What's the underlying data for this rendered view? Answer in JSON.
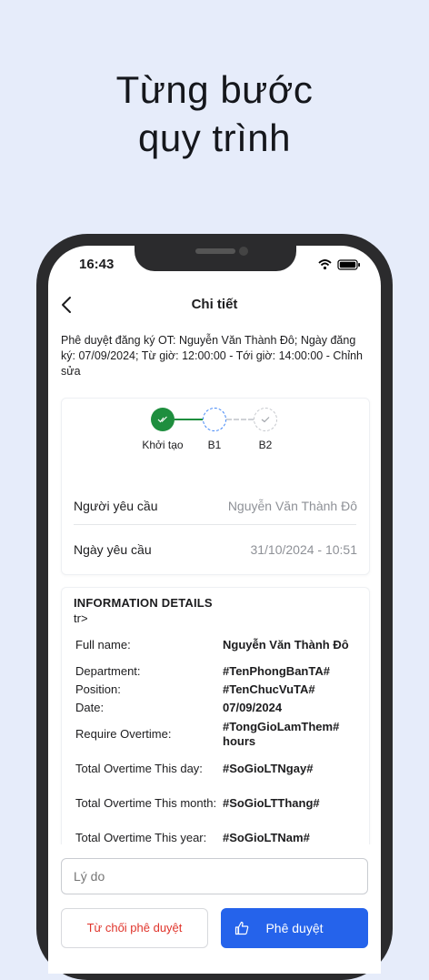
{
  "headline": {
    "line1": "Từng bước",
    "line2": "quy trình"
  },
  "status_bar": {
    "time": "16:43"
  },
  "nav": {
    "title": "Chi tiết",
    "back_icon": "chevron-left-icon"
  },
  "description": "Phê duyệt đăng ký OT: Nguyễn Văn Thành Đô; Ngày đăng ký: 07/09/2024; Từ giờ: 12:00:00 - Tới giờ: 14:00:00 - Chỉnh sửa",
  "workflow": {
    "steps": [
      {
        "label": "Khởi tạo",
        "state": "done"
      },
      {
        "label": "B1",
        "state": "current"
      },
      {
        "label": "B2",
        "state": "pending"
      }
    ]
  },
  "request": {
    "requester_label": "Người yêu cầu",
    "requester_value": "Nguyễn Văn Thành Đô",
    "date_label": "Ngày yêu cầu",
    "date_value": "31/10/2024 - 10:51"
  },
  "info": {
    "title": "INFORMATION DETAILS",
    "stray_text": "tr>",
    "rows": [
      {
        "key": "Full name:",
        "value": "Nguyễn Văn Thành Đô"
      },
      {
        "key": "Department:",
        "value": "#TenPhongBanTA#"
      },
      {
        "key": "Position:",
        "value": "#TenChucVuTA#"
      },
      {
        "key": "Date:",
        "value": "07/09/2024"
      },
      {
        "key": "Require Overtime:",
        "value": "#TongGioLamThem# hours"
      },
      {
        "key": "Total Overtime This day:",
        "value": "#SoGioLTNgay#"
      },
      {
        "key": "Total Overtime This month:",
        "value": "#SoGioLTThang#"
      },
      {
        "key": "Total Overtime This year:",
        "value": "#SoGioLTNam#"
      }
    ]
  },
  "reason": {
    "placeholder": "Lý do"
  },
  "actions": {
    "reject_label": "Từ chối phê duyệt",
    "approve_label": "Phê duyệt"
  },
  "colors": {
    "accent": "#2563eb",
    "done": "#1e8e3e",
    "reject": "#e0342b",
    "background": "#e6ecfa"
  }
}
